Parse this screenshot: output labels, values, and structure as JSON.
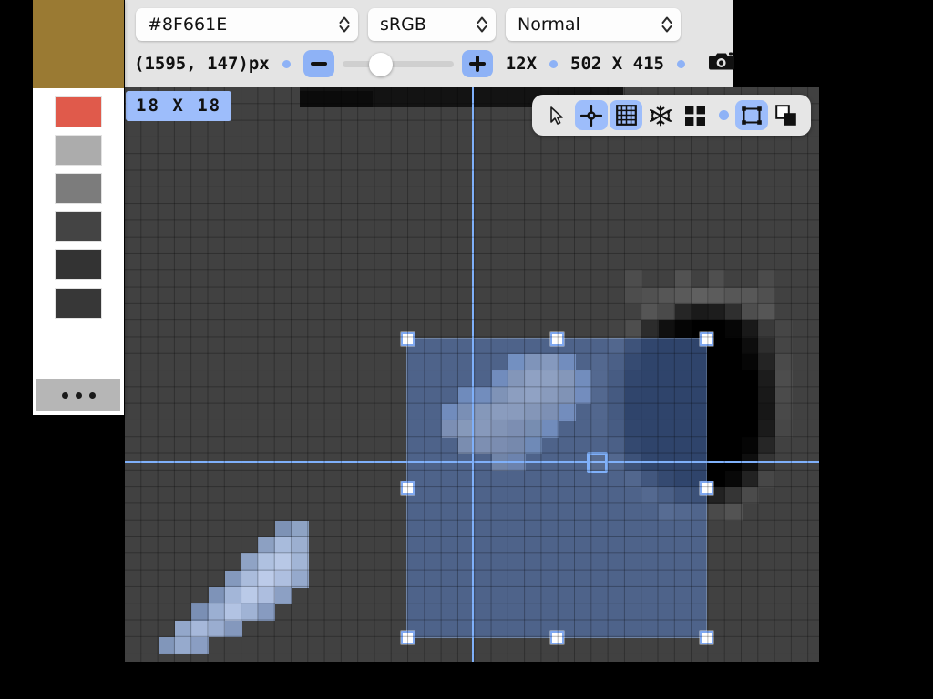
{
  "toolbar": {
    "hex_value": "#8F661E",
    "color_space": "sRGB",
    "blend_mode": "Normal",
    "cursor_position": "(1595, 147)px",
    "zoom_level": "12X",
    "image_size": "502 X 415",
    "zoom_out_icon": "minus-icon",
    "zoom_in_icon": "plus-icon",
    "camera_icon": "camera-icon",
    "slider_percent": 30
  },
  "canvas": {
    "size_badge": "18 X 18",
    "background": "#414141",
    "selection_tint": "#5A82CD",
    "crosshair_color": "#7FB0FA",
    "handle_count": 8
  },
  "tools": [
    {
      "name": "pointer-tool",
      "icon": "cursor-arrow-icon",
      "active": false
    },
    {
      "name": "crosshair-tool",
      "icon": "crosshair-icon",
      "active": true
    },
    {
      "name": "grid-tool",
      "icon": "grid-icon",
      "active": true
    },
    {
      "name": "snap-tool",
      "icon": "snowflake-icon",
      "active": false
    },
    {
      "name": "tiles-tool",
      "icon": "four-squares-icon",
      "active": false
    },
    {
      "name": "dot-separator",
      "icon": "dot-icon",
      "active": false
    },
    {
      "name": "marquee-tool",
      "icon": "selection-rect-icon",
      "active": true
    },
    {
      "name": "layers-tool",
      "icon": "layers-icon",
      "active": false
    }
  ],
  "sidebar": {
    "current_color": "#9A7A33",
    "swatches": [
      {
        "name": "swatch-red",
        "color": "#E05A4B"
      },
      {
        "name": "swatch-light-gray",
        "color": "#ACACAC"
      },
      {
        "name": "swatch-mid-gray",
        "color": "#7C7C7C"
      },
      {
        "name": "swatch-dark-gray",
        "color": "#444444"
      },
      {
        "name": "swatch-darker-gray",
        "color": "#333333"
      },
      {
        "name": "swatch-darkest",
        "color": "#373737"
      }
    ],
    "more_label": "…",
    "more_icon": "ellipsis-icon"
  }
}
